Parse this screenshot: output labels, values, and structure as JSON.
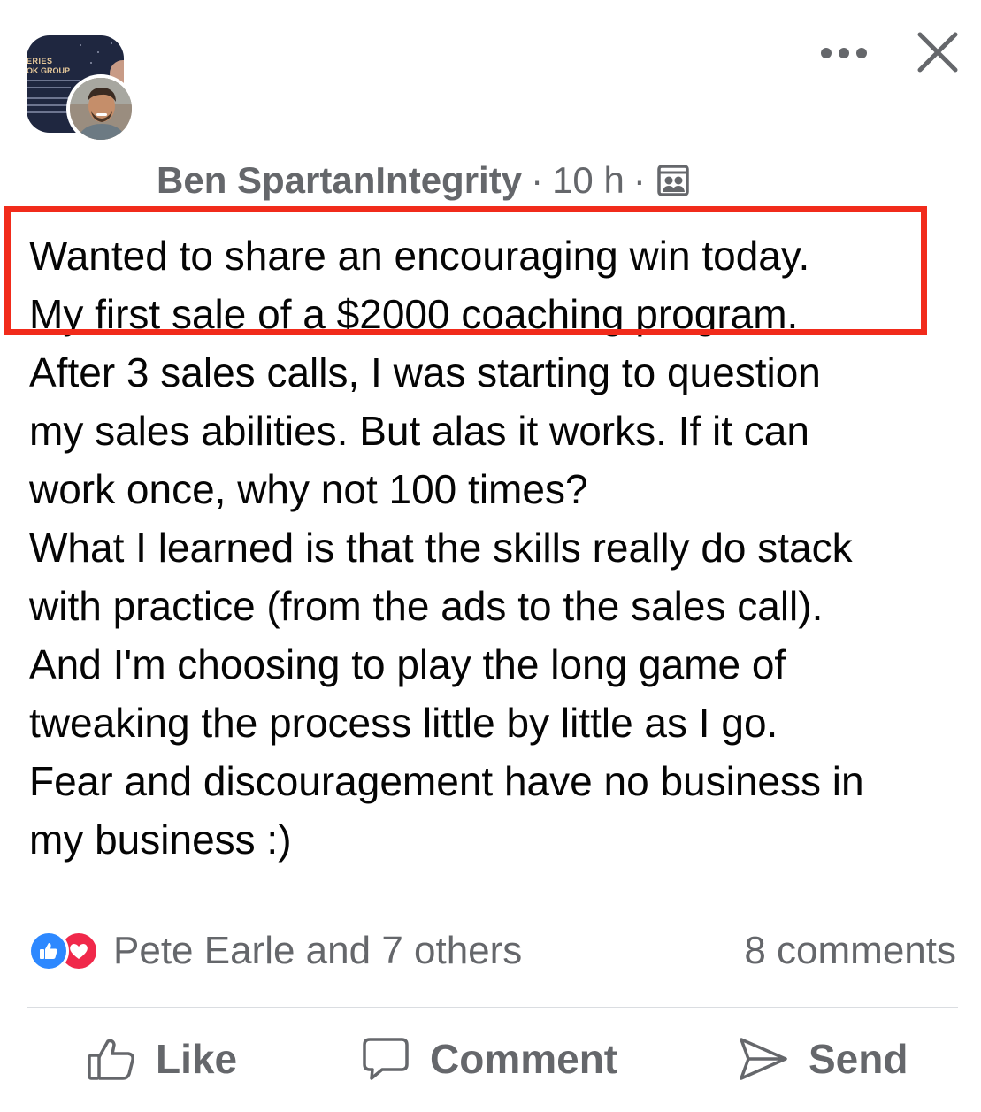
{
  "group": {
    "thumb_text_1": "ERIES",
    "thumb_text_2": "OK GROUP"
  },
  "post": {
    "author": "Ben SpartanIntegrity",
    "time": "10 h",
    "separator": "·",
    "text_lines": [
      "Wanted to share an encouraging win today.",
      "My first sale of a $2000 coaching program.",
      "After 3 sales calls, I was starting to question",
      "my sales abilities. But alas it works. If it can",
      "work once, why not 100 times?",
      "What I learned is that the skills really do stack",
      "with practice (from the ads to the sales call).",
      "And I'm choosing to play the long game of",
      "tweaking the process little by little as I go.",
      "Fear and discouragement have no business in",
      "my business :)"
    ]
  },
  "reactions": {
    "names": "Pete Earle and 7 others",
    "comments": "8 comments"
  },
  "actions": {
    "like": "Like",
    "comment": "Comment",
    "send": "Send"
  },
  "colors": {
    "highlight": "#f12b1b",
    "like_blue": "#2d88ff",
    "love_red": "#f0284a",
    "muted_text": "#65676b"
  },
  "icons": {
    "more": "more-horizontal-icon",
    "close": "close-icon",
    "audience": "group-members-icon",
    "like": "thumbs-up-icon",
    "comment": "speech-bubble-icon",
    "send": "paper-plane-icon"
  }
}
